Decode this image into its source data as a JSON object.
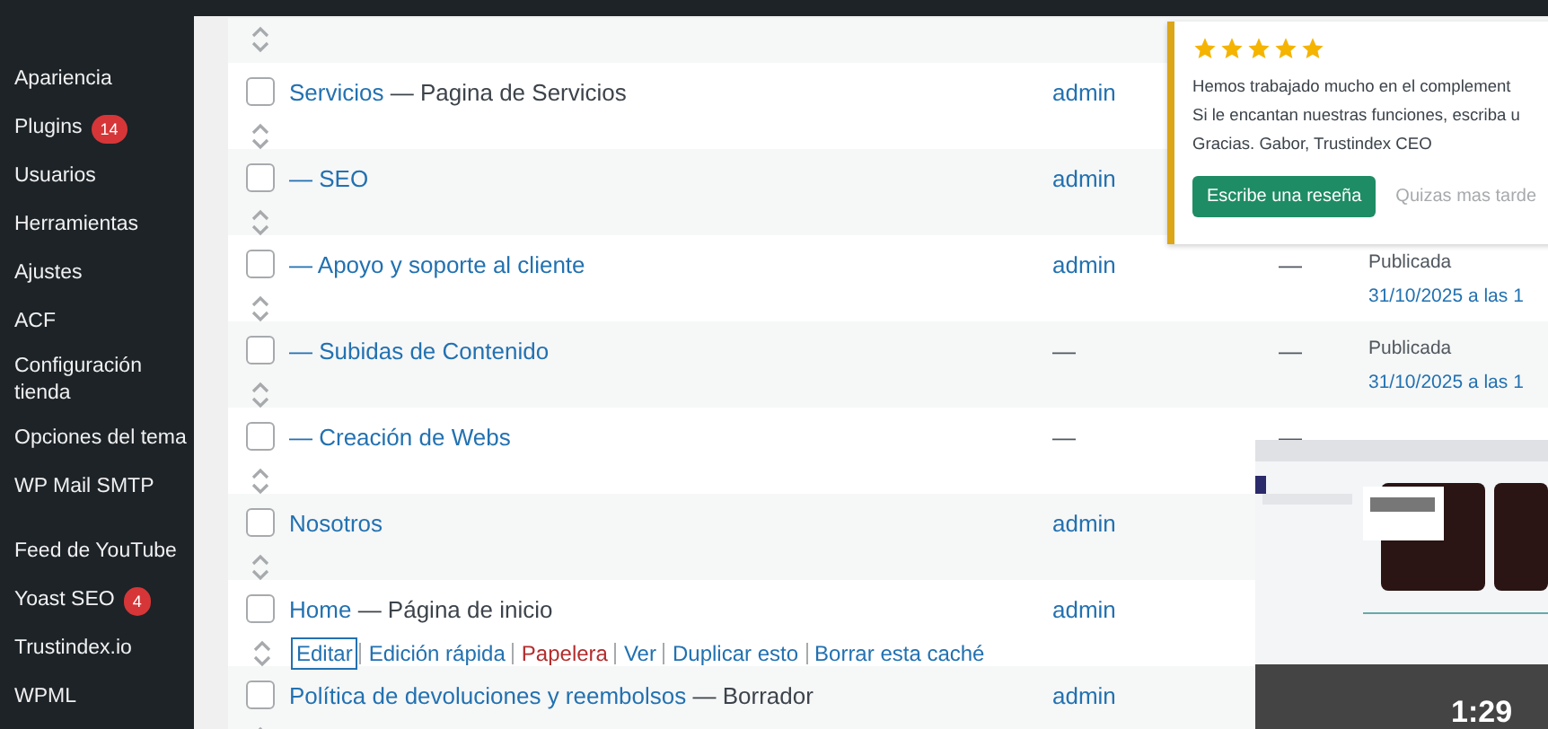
{
  "sidebar": {
    "sections": [
      [
        {
          "label": "Apariencia"
        },
        {
          "label": "Plugins",
          "badge": "14"
        },
        {
          "label": "Usuarios"
        },
        {
          "label": "Herramientas"
        },
        {
          "label": "Ajustes"
        },
        {
          "label": "ACF"
        },
        {
          "label": "Configuración tienda"
        },
        {
          "label": "Opciones del tema"
        },
        {
          "label": "WP Mail SMTP"
        }
      ],
      [
        {
          "label": "Feed de YouTube"
        },
        {
          "label": "Yoast SEO",
          "badge": "4"
        },
        {
          "label": "Trustindex.io"
        },
        {
          "label": "WPML"
        }
      ]
    ]
  },
  "table": {
    "rows": [
      {
        "kind": "partial"
      },
      {
        "kind": "page",
        "checked": false,
        "title": "Servicios",
        "suffix": "— Pagina de Servicios",
        "author": "admin"
      },
      {
        "kind": "page",
        "checked": false,
        "title": "— SEO",
        "author": "admin"
      },
      {
        "kind": "page",
        "checked": false,
        "title": "— Apoyo y soporte al cliente",
        "author": "admin",
        "column_4": "—",
        "status": "Publicada",
        "date": "31/10/2025 a las 1"
      },
      {
        "kind": "page",
        "checked": false,
        "title": "— Subidas de Contenido",
        "author": "—",
        "column_4": "—",
        "status": "Publicada",
        "date": "31/10/2025 a las 1"
      },
      {
        "kind": "page",
        "checked": false,
        "title": "— Creación de Webs",
        "author": "—",
        "column_4": "—"
      },
      {
        "kind": "page",
        "checked": false,
        "title": "Nosotros",
        "author": "admin"
      },
      {
        "kind": "page",
        "checked": false,
        "title": "Home",
        "suffix": "— Página de inicio",
        "author": "admin",
        "actions": [
          {
            "label": "Editar",
            "kind": "link",
            "focused": true
          },
          {
            "label": "Edición rápida",
            "kind": "link",
            "focused": false
          },
          {
            "label": "Papelera",
            "kind": "danger",
            "focused": false
          },
          {
            "label": "Ver",
            "kind": "link",
            "focused": false
          },
          {
            "label": "Duplicar esto",
            "kind": "link",
            "focused": false
          },
          {
            "label": "Borrar esta caché",
            "kind": "link",
            "focused": false
          }
        ]
      },
      {
        "kind": "page",
        "checked": false,
        "title": "Política de devoluciones y reembolsos",
        "suffix": "— Borrador",
        "author": "admin"
      }
    ]
  },
  "review_notice": {
    "stars": 5,
    "lines": [
      "Hemos trabajado mucho en el complement",
      "Si le encantan nuestras funciones, escriba u",
      "Gracias. Gabor, Trustindex CEO"
    ],
    "primary_button": "Escribe una reseña",
    "secondary_button": "Quizas mas tarde"
  },
  "video_overlay": {
    "time": "1:29"
  }
}
